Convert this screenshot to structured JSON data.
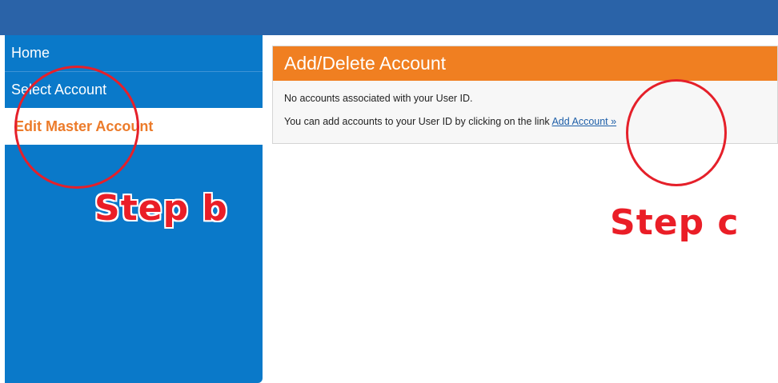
{
  "sidebar": {
    "items": [
      {
        "label": "Home"
      },
      {
        "label": "Select Account"
      },
      {
        "label": "Edit Master Account"
      }
    ]
  },
  "panel": {
    "title": "Add/Delete Account",
    "message_1": "No accounts associated with your User ID.",
    "message_2": "You can add accounts to your User ID by clicking on the link",
    "link_label": "Add Account »"
  },
  "annotations": {
    "step_b": "Step b",
    "step_c": "Step c",
    "circle_color": "#e5202a"
  },
  "colors": {
    "topbar": "#2a63a8",
    "sidebar": "#0a79c9",
    "header_orange": "#f07f21",
    "active_orange": "#ec7b2a"
  }
}
